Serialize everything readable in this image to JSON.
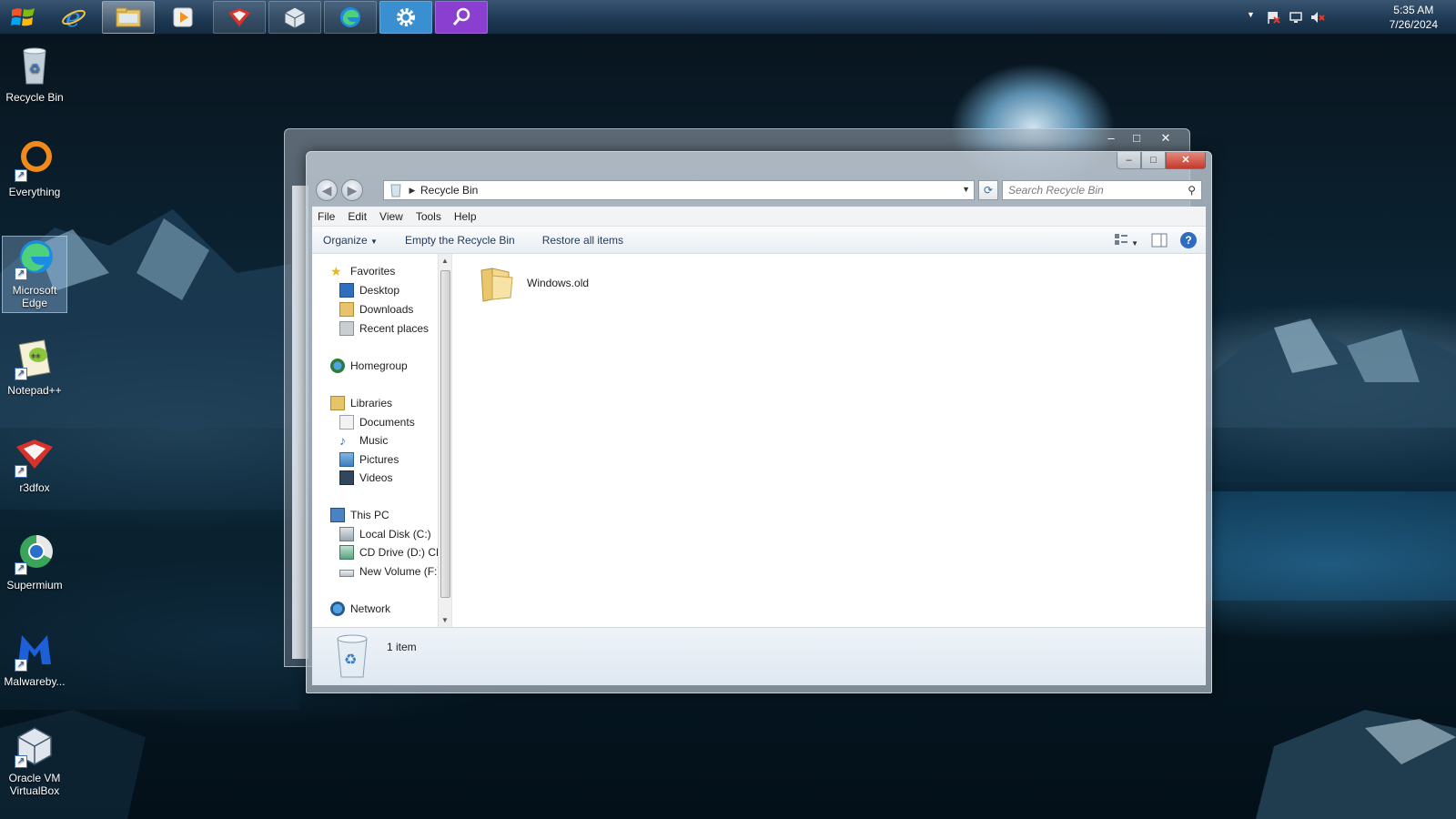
{
  "taskbar": {
    "apps": [
      "Internet Explorer",
      "File Explorer",
      "Media Player",
      "r3dfox",
      "Oracle VM VirtualBox",
      "Microsoft Edge",
      "Settings",
      "Search"
    ],
    "clock": {
      "time": "5:35 AM",
      "date": "7/26/2024"
    }
  },
  "desktop": {
    "icons": [
      {
        "label": "Recycle Bin",
        "icon": "recycle-bin-icon"
      },
      {
        "label": "Everything",
        "icon": "everything-icon"
      },
      {
        "label": "Microsoft Edge",
        "icon": "edge-icon"
      },
      {
        "label": "Notepad++",
        "icon": "notepad-plus-plus-icon"
      },
      {
        "label": "r3dfox",
        "icon": "r3dfox-icon"
      },
      {
        "label": "Supermium",
        "icon": "supermium-icon"
      },
      {
        "label": "Malwareby...",
        "icon": "malwarebytes-icon"
      },
      {
        "label": "Oracle VM VirtualBox",
        "icon": "virtualbox-icon"
      }
    ]
  },
  "window": {
    "address": "Recycle Bin",
    "search_placeholder": "Search Recycle Bin",
    "menu": [
      "File",
      "Edit",
      "View",
      "Tools",
      "Help"
    ],
    "toolbar": {
      "organize": "Organize",
      "empty": "Empty the Recycle Bin",
      "restore": "Restore all items"
    },
    "nav": {
      "favorites": "Favorites",
      "desktop": "Desktop",
      "downloads": "Downloads",
      "recent": "Recent places",
      "homegroup": "Homegroup",
      "libraries": "Libraries",
      "documents": "Documents",
      "music": "Music",
      "pictures": "Pictures",
      "videos": "Videos",
      "thispc": "This PC",
      "local_c": "Local Disk (C:)",
      "cd_d": "CD Drive (D:) CES",
      "new_f": "New Volume (F:)",
      "network": "Network"
    },
    "files": [
      {
        "name": "Windows.old",
        "type": "folder"
      }
    ],
    "status": "1 item"
  }
}
